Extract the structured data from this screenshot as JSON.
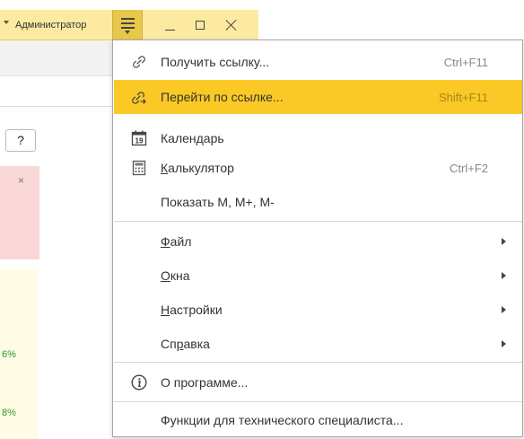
{
  "titlebar": {
    "user_name": "Администратор",
    "icons": {
      "menu": "hamburger-menu-icon",
      "minimize": "minimize-icon",
      "maximize": "maximize-icon",
      "close": "close-icon"
    }
  },
  "background": {
    "help_button_label": "?",
    "notice_close_glyph": "×",
    "percent_values": [
      "6%",
      "8%"
    ]
  },
  "menu": {
    "items": [
      {
        "label": "Получить ссылку...",
        "shortcut": "Ctrl+F11",
        "icon": "link-icon"
      },
      {
        "label": "Перейти по ссылке...",
        "shortcut": "Shift+F11",
        "icon": "follow-link-icon",
        "highlighted": true
      },
      {
        "label": "Календарь",
        "icon": "calendar-icon",
        "calendar_day": "19"
      },
      {
        "label_mnemonic": "К",
        "label_rest": "алькулятор",
        "shortcut": "Ctrl+F2",
        "icon": "calculator-icon"
      },
      {
        "label": "Показать М, М+, М-"
      },
      {
        "label_mnemonic": "Ф",
        "label_rest": "айл",
        "has_submenu": true
      },
      {
        "label_mnemonic": "О",
        "label_rest": "кна",
        "has_submenu": true
      },
      {
        "label_mnemonic": "Н",
        "label_rest": "астройки",
        "has_submenu": true
      },
      {
        "label_pre": "Сп",
        "label_mnemonic": "р",
        "label_rest": "авка",
        "has_submenu": true
      },
      {
        "label": "О программе...",
        "icon": "info-icon"
      },
      {
        "label": "Функции для технического специалиста..."
      }
    ]
  },
  "colors": {
    "titlebar_bg": "#fbeaa0",
    "menu_button_bg": "#e9c74a",
    "highlight": "#fbc926",
    "percent_green": "#2c9b2c",
    "notice_pink": "#f9d7d7"
  }
}
